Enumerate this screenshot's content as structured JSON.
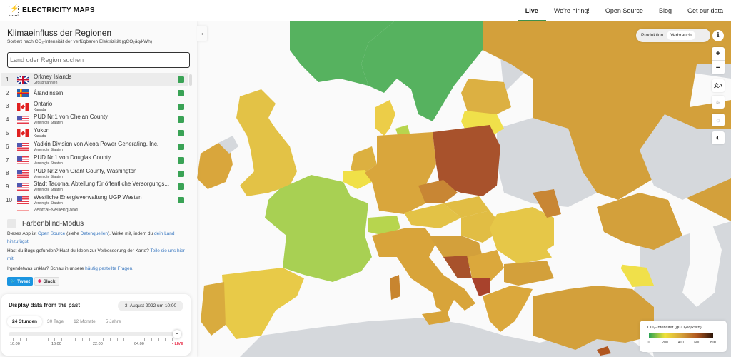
{
  "header": {
    "logo_text": "ELECTRICITY MAPS",
    "nav": [
      {
        "label": "Live",
        "active": true
      },
      {
        "label": "We're hiring!",
        "active": false
      },
      {
        "label": "Open Source",
        "active": false
      },
      {
        "label": "Blog",
        "active": false
      },
      {
        "label": "Get our data",
        "active": false
      }
    ]
  },
  "sidebar": {
    "title": "Klimaeinfluss der Regionen",
    "subtitle": "Sortiert nach CO₂-Intensität der verfügbaren Elektrizität (gCO₂äq/kWh)",
    "search_placeholder": "Land oder Region suchen",
    "collapse_icon": "◂",
    "rankings": [
      {
        "rank": "1",
        "name": "Orkney Islands",
        "country": "Großbritannien",
        "flag": "gb",
        "color": "#3aa356"
      },
      {
        "rank": "2",
        "name": "Ålandinseln",
        "country": "",
        "flag": "ax",
        "color": "#3aa356"
      },
      {
        "rank": "3",
        "name": "Ontario",
        "country": "Kanada",
        "flag": "ca",
        "color": "#3aa356"
      },
      {
        "rank": "4",
        "name": "PUD Nr.1 von Chelan County",
        "country": "Vereinigte Staaten",
        "flag": "us",
        "color": "#3aa356"
      },
      {
        "rank": "5",
        "name": "Yukon",
        "country": "Kanada",
        "flag": "ca",
        "color": "#3aa356"
      },
      {
        "rank": "6",
        "name": "Yadkin Division von Alcoa Power Generating, Inc.",
        "country": "Vereinigte Staaten",
        "flag": "us",
        "color": "#3aa356"
      },
      {
        "rank": "7",
        "name": "PUD Nr.1 von Douglas County",
        "country": "Vereinigte Staaten",
        "flag": "us",
        "color": "#3aa356"
      },
      {
        "rank": "8",
        "name": "PUD Nr.2 von Grant County, Washington",
        "country": "Vereinigte Staaten",
        "flag": "us",
        "color": "#3aa356"
      },
      {
        "rank": "9",
        "name": "Stadt Tacoma, Abteilung für öffentliche Versorgungs...",
        "country": "Vereinigte Staaten",
        "flag": "us",
        "color": "#3aa356"
      },
      {
        "rank": "10",
        "name": "Westliche Energieverwaltung UGP Westen",
        "country": "Vereinigte Staaten",
        "flag": "us",
        "color": "#3aa356"
      }
    ],
    "partial_item": "Zentral-Neuengland",
    "colorblind_label": "Farbenblind-Modus",
    "para1": {
      "t1": "Dieses App ist ",
      "l1": "Open Source",
      "t2": " (siehe ",
      "l2": "Datenquellen",
      "t3": "). Wirke mit, indem du ",
      "l3": "dein Land hinzufügst",
      "t4": "."
    },
    "para2": {
      "t1": "Hast du Bugs gefunden? Hast du Ideen zur Verbesserung der Karte? ",
      "l1": "Teile sie uns hier mit",
      "t2": "."
    },
    "para3": {
      "t1": "Irgendetwas unklar? Schau in unsere ",
      "l1": "häufig gestellte Fragen",
      "t2": "."
    },
    "tweet_label": "Tweet",
    "slack_label": "Slack"
  },
  "time_panel": {
    "title": "Display data from the past",
    "date": "3. August 2022 um 10:00",
    "tabs": [
      {
        "label": "24 Stunden",
        "active": true
      },
      {
        "label": "30 Tage",
        "active": false
      },
      {
        "label": "12 Monate",
        "active": false
      },
      {
        "label": "5 Jahre",
        "active": false
      }
    ],
    "slider_position": 1.0,
    "knob_label": "••",
    "tick_labels": [
      "10:00",
      "16:00",
      "22:00",
      "04:00"
    ],
    "live_label": "• LIVE"
  },
  "map_controls": {
    "mode_toggle": [
      {
        "label": "Produktion",
        "active": false
      },
      {
        "label": "Verbrauch",
        "active": true
      }
    ],
    "info_label": "i",
    "zoom_in": "+",
    "zoom_out": "−",
    "buttons": [
      {
        "name": "language-icon",
        "glyph": "文A"
      },
      {
        "name": "wind-icon",
        "glyph": "≋"
      },
      {
        "name": "sun-icon",
        "glyph": "☼"
      },
      {
        "name": "dark-mode-icon",
        "glyph": "◐"
      }
    ]
  },
  "legend": {
    "title": "CO₂-Intensität (gCO₂eq/kWh)",
    "ticks": [
      "0",
      "200",
      "400",
      "600",
      "800"
    ],
    "scale_colors": [
      "#2aa352",
      "#f0e23a",
      "#d6a43a",
      "#b0561f",
      "#2a1408"
    ]
  },
  "map_regions": [
    {
      "name": "Norway",
      "color": "#56b25f"
    },
    {
      "name": "Sweden",
      "color": "#56b25f"
    },
    {
      "name": "United Kingdom",
      "color": "#e3c246"
    },
    {
      "name": "Ireland",
      "color": "#d9a63c"
    },
    {
      "name": "Northern Ireland",
      "color": "#d5d8dc"
    },
    {
      "name": "Denmark",
      "color": "#eccd48"
    },
    {
      "name": "Germany",
      "color": "#d9a63c"
    },
    {
      "name": "Poland",
      "color": "#a8522c"
    },
    {
      "name": "Czechia",
      "color": "#c88634"
    },
    {
      "name": "France",
      "color": "#a8d053"
    },
    {
      "name": "Switzerland",
      "color": "#b7d54e"
    },
    {
      "name": "Belgium",
      "color": "#f0e048"
    },
    {
      "name": "Netherlands",
      "color": "#dcb040"
    },
    {
      "name": "Spain",
      "color": "#e8ca48"
    },
    {
      "name": "Portugal",
      "color": "#d9ab3e"
    },
    {
      "name": "Italy",
      "color": "#d8a43a"
    },
    {
      "name": "Austria",
      "color": "#e3c246"
    },
    {
      "name": "Hungary",
      "color": "#e1bd44"
    },
    {
      "name": "Romania",
      "color": "#e6c748"
    },
    {
      "name": "Bosnia",
      "color": "#a8522c"
    },
    {
      "name": "Baltic",
      "color": "#dcb042"
    },
    {
      "name": "Lithuania",
      "color": "#f0e04a"
    },
    {
      "name": "Finland",
      "color": "#d3a03b"
    },
    {
      "name": "Russia",
      "color": "#d3a03b"
    },
    {
      "name": "Turkey",
      "color": "#d3a03b"
    },
    {
      "name": "Georgia",
      "color": "#f0e04a"
    },
    {
      "name": "Bulgaria",
      "color": "#d3a03b"
    },
    {
      "name": "Greece",
      "color": "#dba83c"
    },
    {
      "name": "Sardinia",
      "color": "#c8852f"
    }
  ]
}
